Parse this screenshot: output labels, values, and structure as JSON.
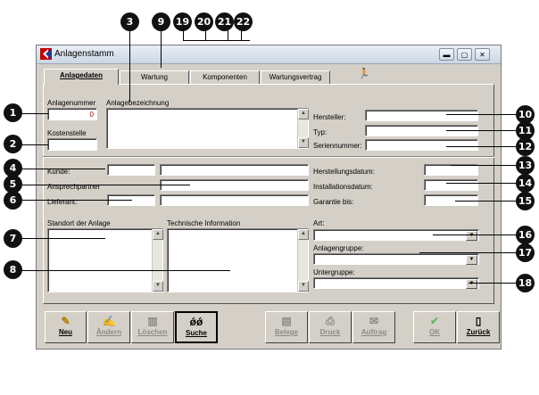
{
  "window": {
    "title": "Anlagenstamm"
  },
  "tabs": [
    {
      "label": "Anlagedaten"
    },
    {
      "label": "Wartung"
    },
    {
      "label": "Komponenten"
    },
    {
      "label": "Wartungsvertrag"
    }
  ],
  "fields": {
    "anlagenummer": {
      "label": "Anlagenummer",
      "value": "0"
    },
    "anlagebezeichnung": {
      "label": "Anlagebezeichnung"
    },
    "kostenstelle": {
      "label": "Kostenstelle"
    },
    "hersteller": {
      "label": "Hersteller:"
    },
    "typ": {
      "label": "Typ:"
    },
    "seriennummer": {
      "label": "Seriennummer:"
    },
    "kunde": {
      "label": "Kunde:"
    },
    "ansprechpartner": {
      "label": "Ansprechpartner"
    },
    "lieferant": {
      "label": "Lieferant:"
    },
    "herstellungsdatum": {
      "label": "Herstellungsdatum:"
    },
    "installationsdatum": {
      "label": "Installationsdatum:"
    },
    "garantie": {
      "label": "Garantie bis:"
    },
    "standort": {
      "label": "Standort der Anlage"
    },
    "technische_info": {
      "label": "Technische Information"
    },
    "art": {
      "label": "Art:"
    },
    "anlagengruppe": {
      "label": "Anlagengruppe:"
    },
    "untergruppe": {
      "label": "Untergruppe:"
    }
  },
  "buttons": [
    {
      "label": "Neu",
      "icon": "pencil-icon",
      "glyph": "✎",
      "enabled": true
    },
    {
      "label": "Ändern",
      "icon": "edit-icon",
      "glyph": "✍",
      "enabled": false
    },
    {
      "label": "Löschen",
      "icon": "trash-icon",
      "glyph": "🗑",
      "enabled": false
    },
    {
      "label": "Suche",
      "icon": "binoculars-icon",
      "glyph": "🔭",
      "enabled": true
    },
    {
      "label": "Belege",
      "icon": "documents-icon",
      "glyph": "📑",
      "enabled": false
    },
    {
      "label": "Druck",
      "icon": "printer-icon",
      "glyph": "🖶",
      "enabled": false
    },
    {
      "label": "Auftrag",
      "icon": "order-icon",
      "glyph": "✉",
      "enabled": false
    },
    {
      "label": "OK",
      "icon": "check-icon",
      "glyph": "✔",
      "enabled": false
    },
    {
      "label": "Zurück",
      "icon": "door-icon",
      "glyph": "🚪",
      "enabled": true
    }
  ],
  "callouts": [
    "1",
    "2",
    "3",
    "4",
    "5",
    "6",
    "7",
    "8",
    "9",
    "10",
    "11",
    "12",
    "13",
    "14",
    "15",
    "16",
    "17",
    "18",
    "19",
    "20",
    "21",
    "22"
  ],
  "colors": {
    "value_red": "#a00000",
    "window_bg": "#d4d0c8"
  }
}
